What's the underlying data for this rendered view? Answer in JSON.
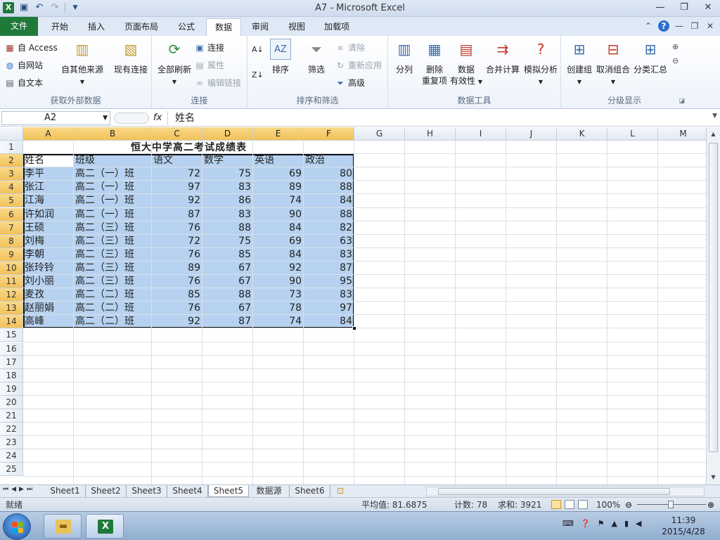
{
  "window": {
    "title": "A7  -  Microsoft Excel"
  },
  "ribbon_tabs": [
    "文件",
    "开始",
    "插入",
    "页面布局",
    "公式",
    "数据",
    "审阅",
    "视图",
    "加载项"
  ],
  "ribbon": {
    "external": {
      "access": "自 Access",
      "web": "自网站",
      "text": "自文本",
      "other": "自其他来源",
      "existing": "现有连接",
      "label": "获取外部数据"
    },
    "connections": {
      "refresh_all": "全部刷新",
      "connect": "连接",
      "properties": "属性",
      "edit_links": "编辑链接",
      "label": "连接"
    },
    "sort_filter": {
      "sort": "排序",
      "filter": "筛选",
      "clear": "清除",
      "reapply": "重新应用",
      "advanced": "高级",
      "label": "排序和筛选"
    },
    "data_tools": {
      "text_to_cols": "分列",
      "remove_dup_1": "删除",
      "remove_dup_2": "重复项",
      "validation_1": "数据",
      "validation_2": "有效性",
      "consolidate": "合并计算",
      "what_if": "模拟分析",
      "label": "数据工具"
    },
    "outline": {
      "group": "创建组",
      "ungroup": "取消组合",
      "subtotal": "分类汇总",
      "label": "分级显示"
    }
  },
  "formula_bar": {
    "name_box": "A2",
    "fx": "fx",
    "content": "姓名"
  },
  "columns": [
    "A",
    "B",
    "C",
    "D",
    "E",
    "F",
    "G",
    "H",
    "I",
    "J",
    "K",
    "L",
    "M"
  ],
  "rows": [
    "1",
    "2",
    "3",
    "4",
    "5",
    "6",
    "7",
    "8",
    "9",
    "10",
    "11",
    "12",
    "13",
    "14",
    "15",
    "16",
    "17",
    "18",
    "19",
    "20",
    "21",
    "22",
    "23",
    "24",
    "25"
  ],
  "sheet_title": "恒大中学高二考试成绩表",
  "headers": [
    "姓名",
    "班级",
    "语文",
    "数学",
    "英语",
    "政治"
  ],
  "table": [
    [
      "李平",
      "高二（一）班",
      "72",
      "75",
      "69",
      "80"
    ],
    [
      "张江",
      "高二（一）班",
      "97",
      "83",
      "89",
      "88"
    ],
    [
      "江海",
      "高二（一）班",
      "92",
      "86",
      "74",
      "84"
    ],
    [
      "许如润",
      "高二（一）班",
      "87",
      "83",
      "90",
      "88"
    ],
    [
      "王硕",
      "高二（三）班",
      "76",
      "88",
      "84",
      "82"
    ],
    [
      "刘梅",
      "高二（三）班",
      "72",
      "75",
      "69",
      "63"
    ],
    [
      "李朝",
      "高二（三）班",
      "76",
      "85",
      "84",
      "83"
    ],
    [
      "张玲铃",
      "高二（三）班",
      "89",
      "67",
      "92",
      "87"
    ],
    [
      "刘小丽",
      "高二（三）班",
      "76",
      "67",
      "90",
      "95"
    ],
    [
      "麦孜",
      "高二（二）班",
      "85",
      "88",
      "73",
      "83"
    ],
    [
      "赵丽娟",
      "高二（二）班",
      "76",
      "67",
      "78",
      "97"
    ],
    [
      "高峰",
      "高二（二）班",
      "92",
      "87",
      "74",
      "84"
    ]
  ],
  "sheets": [
    "Sheet1",
    "Sheet2",
    "Sheet3",
    "Sheet4",
    "Sheet5",
    "数据源",
    "Sheet6"
  ],
  "active_sheet": "Sheet5",
  "status": {
    "ready": "就绪",
    "average": "平均值: 81.6875",
    "count": "计数: 78",
    "sum": "求和: 3921",
    "zoom": "100%"
  },
  "taskbar": {
    "time": "11:39",
    "date": "2015/4/28"
  },
  "colors": {
    "selection": "#b7d2f0",
    "header_highlight": "#f2c158",
    "excel_green": "#1f7a3a"
  }
}
